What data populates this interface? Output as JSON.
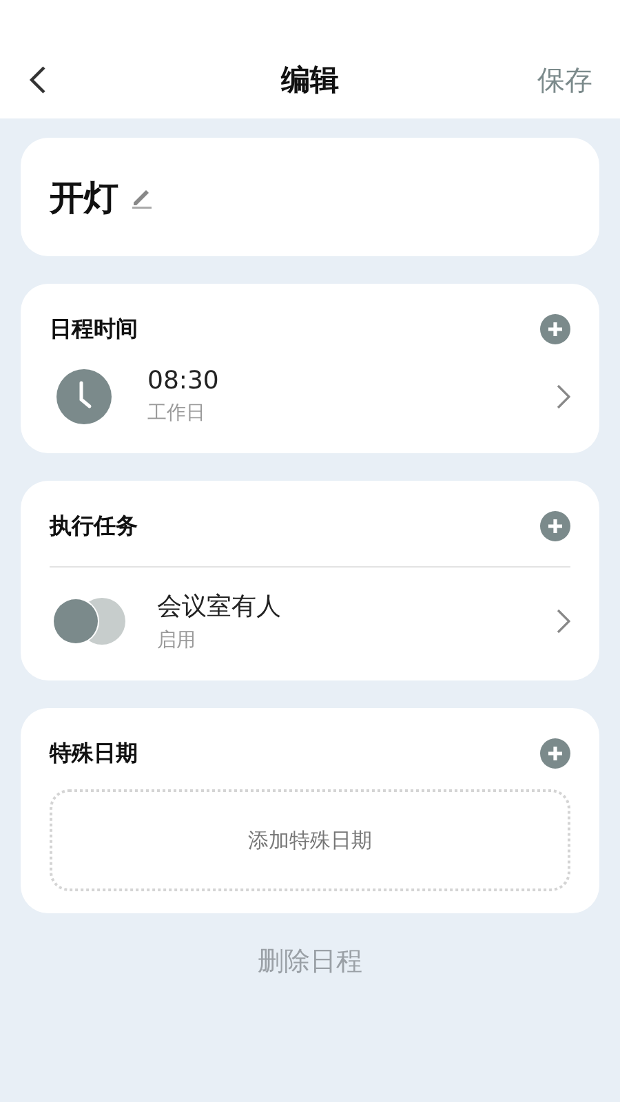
{
  "header": {
    "title": "编辑",
    "save": "保存"
  },
  "name": {
    "text": "开灯"
  },
  "sections": [
    {
      "kind": "time",
      "title": "日程时间",
      "items": [
        {
          "primary": "08:30",
          "secondary": "工作日"
        }
      ]
    },
    {
      "kind": "task",
      "title": "执行任务",
      "items": [
        {
          "primary": "会议室有人",
          "secondary": "启用"
        }
      ]
    },
    {
      "kind": "special",
      "title": "特殊日期",
      "add_label": "添加特殊日期"
    }
  ],
  "delete": "删除日程"
}
